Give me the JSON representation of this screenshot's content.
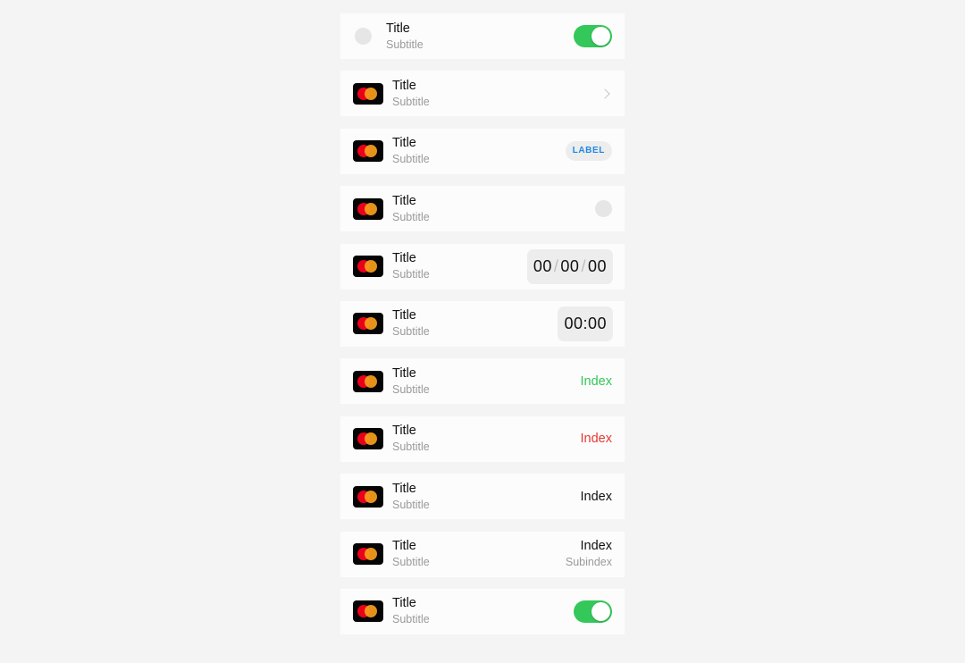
{
  "rows": [
    {
      "title": "Title",
      "subtitle": "Subtitle",
      "right": "toggle",
      "toggle_on": true
    },
    {
      "title": "Title",
      "subtitle": "Subtitle",
      "right": "chevron"
    },
    {
      "title": "Title",
      "subtitle": "Subtitle",
      "right": "label",
      "label": "LABEL"
    },
    {
      "title": "Title",
      "subtitle": "Subtitle",
      "right": "dot"
    },
    {
      "title": "Title",
      "subtitle": "Subtitle",
      "right": "date",
      "date": [
        "00",
        "00",
        "00"
      ],
      "date_sep": "/"
    },
    {
      "title": "Title",
      "subtitle": "Subtitle",
      "right": "time",
      "time": "00:00"
    },
    {
      "title": "Title",
      "subtitle": "Subtitle",
      "right": "index",
      "index": "Index",
      "index_color": "#34c759"
    },
    {
      "title": "Title",
      "subtitle": "Subtitle",
      "right": "index",
      "index": "Index",
      "index_color": "#e53935"
    },
    {
      "title": "Title",
      "subtitle": "Subtitle",
      "right": "index",
      "index": "Index",
      "index_color": "#111111"
    },
    {
      "title": "Title",
      "subtitle": "Subtitle",
      "right": "index-sub",
      "index": "Index",
      "subindex": "Subindex"
    },
    {
      "title": "Title",
      "subtitle": "Subtitle",
      "right": "toggle",
      "toggle_on": true
    }
  ],
  "icons": {
    "row0_left": "placeholder-dot-icon",
    "rows_left": "mastercard-icon"
  },
  "colors": {
    "toggle_on": "#34c759",
    "label_text": "#1e88e5",
    "index_green": "#34c759",
    "index_red": "#e53935"
  }
}
